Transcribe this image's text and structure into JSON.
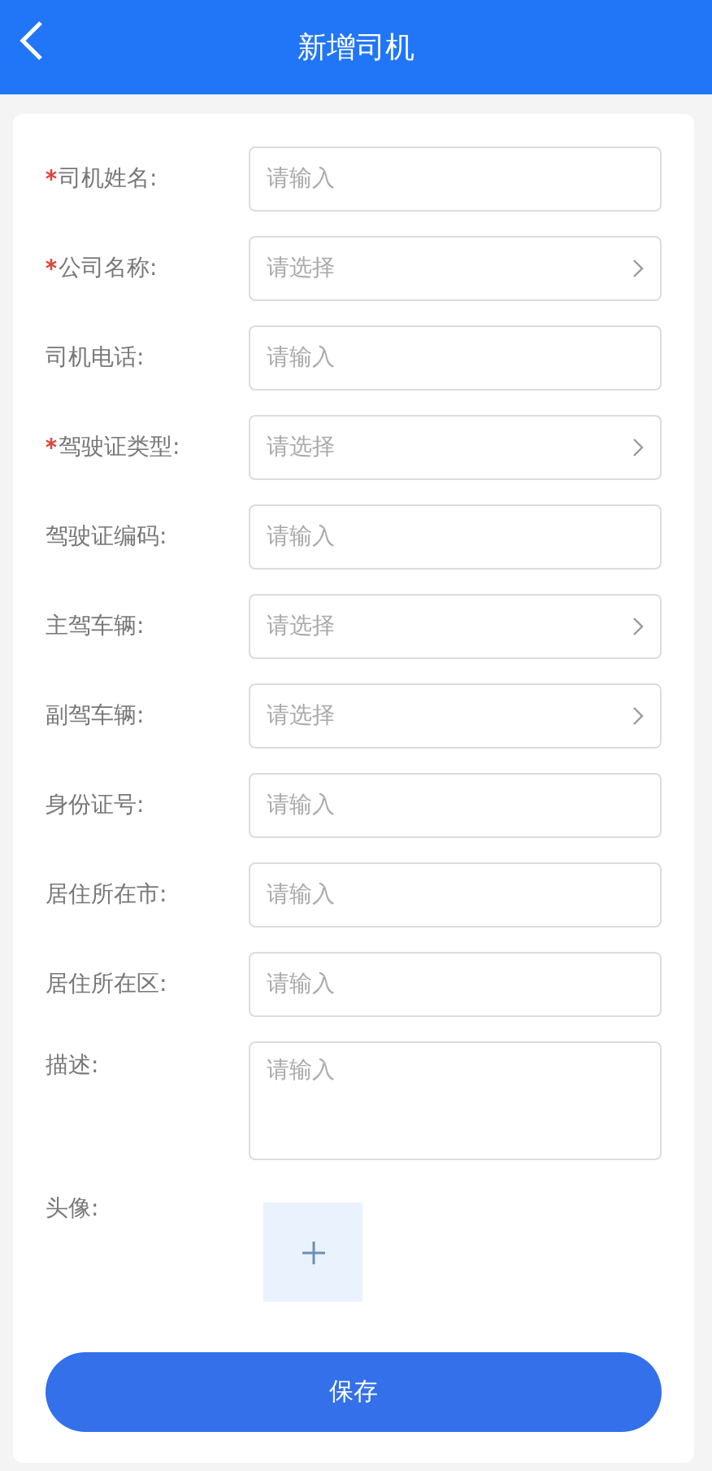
{
  "header": {
    "title": "新增司机"
  },
  "fields": [
    {
      "label": "司机姓名:",
      "kind": "input",
      "required": true,
      "placeholder": "请输入"
    },
    {
      "label": "公司名称:",
      "kind": "select",
      "required": true,
      "placeholder": "请选择"
    },
    {
      "label": "司机电话:",
      "kind": "input",
      "required": false,
      "placeholder": "请输入"
    },
    {
      "label": "驾驶证类型:",
      "kind": "select",
      "required": true,
      "placeholder": "请选择"
    },
    {
      "label": "驾驶证编码:",
      "kind": "input",
      "required": false,
      "placeholder": "请输入"
    },
    {
      "label": "主驾车辆:",
      "kind": "select",
      "required": false,
      "placeholder": "请选择"
    },
    {
      "label": "副驾车辆:",
      "kind": "select",
      "required": false,
      "placeholder": "请选择"
    },
    {
      "label": "身份证号:",
      "kind": "input",
      "required": false,
      "placeholder": "请输入"
    },
    {
      "label": "居住所在市:",
      "kind": "input",
      "required": false,
      "placeholder": "请输入"
    },
    {
      "label": "居住所在区:",
      "kind": "input",
      "required": false,
      "placeholder": "请输入"
    },
    {
      "label": "描述:",
      "kind": "textarea",
      "required": false,
      "placeholder": "请输入"
    },
    {
      "label": "头像:",
      "kind": "upload",
      "required": false
    }
  ],
  "save_button": {
    "label": "保存"
  }
}
